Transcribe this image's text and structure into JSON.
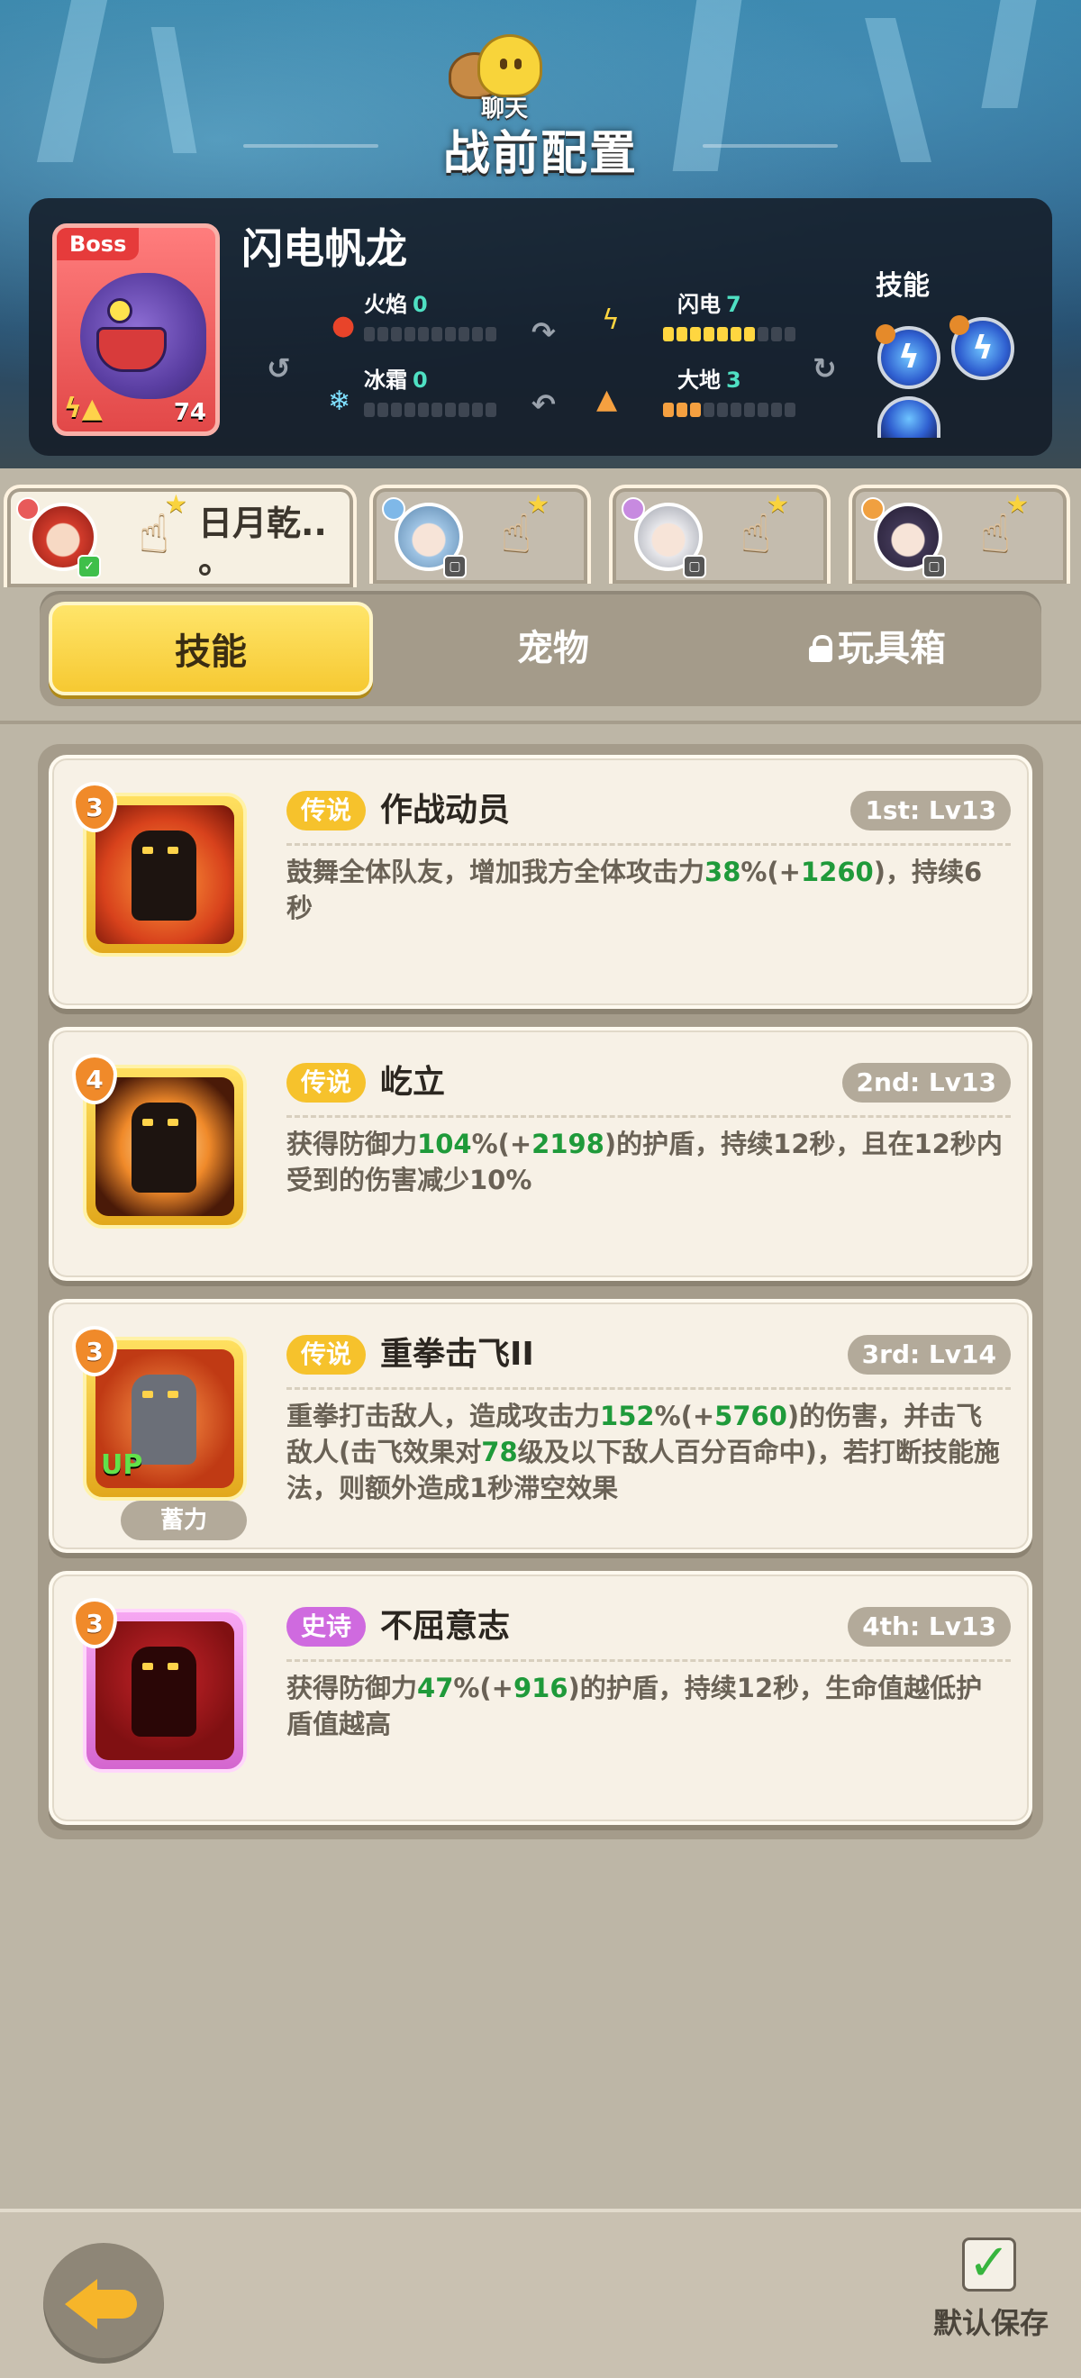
{
  "header": {
    "chat_label": "聊天",
    "title": "战前配置"
  },
  "boss": {
    "tag": "Boss",
    "name": "闪电帆龙",
    "level": "74",
    "elements": [
      {
        "label": "火焰",
        "value": "0"
      },
      {
        "label": "冰霜",
        "value": "0"
      },
      {
        "label": "闪电",
        "value": "7"
      },
      {
        "label": "大地",
        "value": "3"
      }
    ],
    "skills_title": "技能"
  },
  "heroes": [
    {
      "name": "日月乾..\n。",
      "active": true
    },
    {
      "name": "",
      "active": false
    },
    {
      "name": "",
      "active": false
    },
    {
      "name": "",
      "active": false
    }
  ],
  "category_tabs": {
    "skills": "技能",
    "pets": "宠物",
    "toybox": "玩具箱"
  },
  "skills": [
    {
      "cost": "3",
      "rarity": "传说",
      "name": "作战动员",
      "slot": "1st: Lv13",
      "desc_parts": [
        "鼓舞全体队友，增加我方全体攻击力",
        "38",
        "%(+",
        "1260",
        ")，持续6秒"
      ]
    },
    {
      "cost": "4",
      "rarity": "传说",
      "name": "屹立",
      "slot": "2nd: Lv13",
      "desc_parts": [
        "获得防御力",
        "104",
        "%(+",
        "2198",
        ")的护盾，持续12秒，且在12秒内受到的伤害减少10%"
      ]
    },
    {
      "cost": "3",
      "rarity": "传说",
      "name": "重拳击飞II",
      "slot": "3rd: Lv14",
      "up_label": "UP",
      "charge_label": "蓄力",
      "desc_parts": [
        "重拳打击敌人，造成攻击力",
        "152",
        "%(+",
        "5760",
        ")的伤害，并击飞敌人(击飞效果对",
        "78",
        "级及以下敌人百分百命中)，若打断技能施法，则额外造成1秒滞空效果"
      ]
    },
    {
      "cost": "3",
      "rarity": "史诗",
      "name": "不屈意志",
      "slot": "4th: Lv13",
      "desc_parts": [
        "获得防御力",
        "47",
        "%(+",
        "916",
        ")的护盾，持续12秒，生命值越低护盾值越高"
      ]
    }
  ],
  "footer": {
    "save_label": "默认保存"
  },
  "colors": {
    "legend_gold": "#f6c22c",
    "epic_purple": "#cf6adf",
    "value_green": "#1f9a3a",
    "active_tab": "#f6c932"
  }
}
